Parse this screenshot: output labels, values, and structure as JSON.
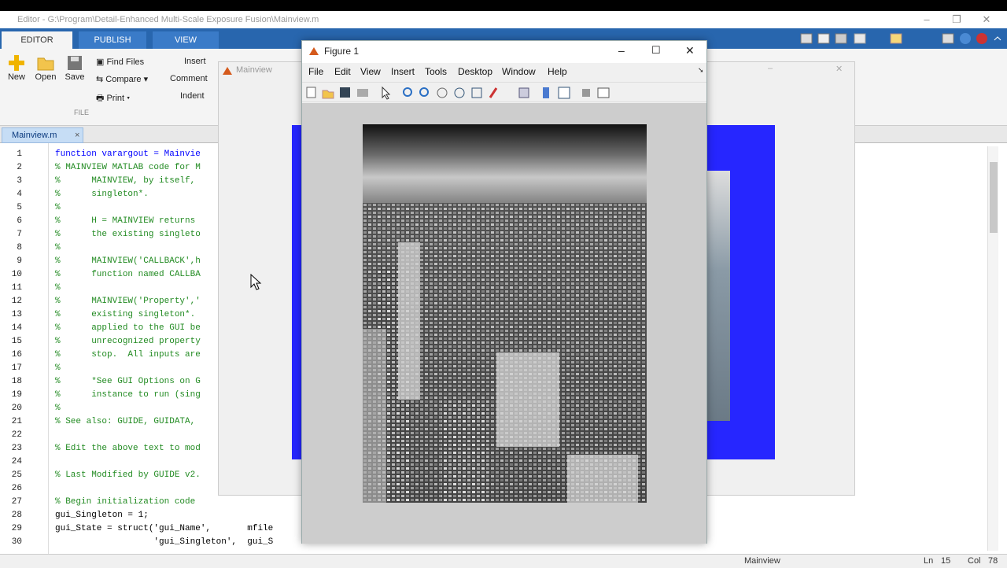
{
  "window": {
    "title": "Editor - G:\\Program\\Detail-Enhanced Multi-Scale Exposure Fusion\\Mainview.m"
  },
  "ribbon": {
    "tabs": [
      {
        "label": "EDITOR"
      },
      {
        "label": "PUBLISH"
      },
      {
        "label": "VIEW"
      }
    ],
    "new_label": "New",
    "open_label": "Open",
    "save_label": "Save",
    "find_files": "Find Files",
    "compare": "Compare",
    "print": "Print",
    "insert": "Insert",
    "comment": "Comment",
    "indent": "Indent",
    "section_file": "FILE"
  },
  "doc_tab": {
    "label": "Mainview.m"
  },
  "code_lines": [
    {
      "n": "1",
      "text": "function varargout = Mainvie",
      "type": "kw"
    },
    {
      "n": "2",
      "text": "% MAINVIEW MATLAB code for M",
      "type": "cm"
    },
    {
      "n": "3",
      "text": "%      MAINVIEW, by itself,",
      "type": "cm"
    },
    {
      "n": "4",
      "text": "%      singleton*.",
      "type": "cm"
    },
    {
      "n": "5",
      "text": "%",
      "type": "cm"
    },
    {
      "n": "6",
      "text": "%      H = MAINVIEW returns",
      "type": "cm"
    },
    {
      "n": "7",
      "text": "%      the existing singleto",
      "type": "cm"
    },
    {
      "n": "8",
      "text": "%",
      "type": "cm"
    },
    {
      "n": "9",
      "text": "%      MAINVIEW('CALLBACK',h",
      "type": "cm"
    },
    {
      "n": "10",
      "text": "%      function named CALLBA",
      "type": "cm"
    },
    {
      "n": "11",
      "text": "%",
      "type": "cm"
    },
    {
      "n": "12",
      "text": "%      MAINVIEW('Property','",
      "type": "cm"
    },
    {
      "n": "13",
      "text": "%      existing singleton*.",
      "type": "cm"
    },
    {
      "n": "14",
      "text": "%      applied to the GUI be",
      "type": "cm"
    },
    {
      "n": "15",
      "text": "%      unrecognized property",
      "type": "cm"
    },
    {
      "n": "16",
      "text": "%      stop.  All inputs are",
      "type": "cm"
    },
    {
      "n": "17",
      "text": "%",
      "type": "cm"
    },
    {
      "n": "18",
      "text": "%      *See GUI Options on G",
      "type": "cm"
    },
    {
      "n": "19",
      "text": "%      instance to run (sing",
      "type": "cm"
    },
    {
      "n": "20",
      "text": "%",
      "type": "cm"
    },
    {
      "n": "21",
      "text": "% See also: GUIDE, GUIDATA,",
      "type": "cm"
    },
    {
      "n": "22",
      "text": "",
      "type": "cm"
    },
    {
      "n": "23",
      "text": "% Edit the above text to mod",
      "type": "cm"
    },
    {
      "n": "24",
      "text": "",
      "type": "cm"
    },
    {
      "n": "25",
      "text": "% Last Modified by GUIDE v2.",
      "type": "cm"
    },
    {
      "n": "26",
      "text": "",
      "type": "cm"
    },
    {
      "n": "27",
      "text": "% Begin initialization code",
      "type": "cm"
    },
    {
      "n": "28",
      "text": "gui_Singleton = 1;",
      "type": "pl"
    },
    {
      "n": "29",
      "text": "gui_State = struct('gui_Name',       mfile",
      "type": "pl"
    },
    {
      "n": "30",
      "text": "                   'gui_Singleton',  gui_S",
      "type": "pl"
    }
  ],
  "mainview_window": {
    "title": "Mainview"
  },
  "figure": {
    "title": "Figure 1",
    "menus": [
      {
        "label": "File"
      },
      {
        "label": "Edit"
      },
      {
        "label": "View"
      },
      {
        "label": "Insert"
      },
      {
        "label": "Tools"
      },
      {
        "label": "Desktop"
      },
      {
        "label": "Window"
      },
      {
        "label": "Help"
      }
    ]
  },
  "status": {
    "script": "Mainview",
    "ln_label": "Ln",
    "ln": "15",
    "col_label": "Col",
    "col": "78"
  },
  "colors": {
    "ribbon_blue": "#2866ae",
    "panel_blue": "#2626ff",
    "comment_green": "#228b22"
  }
}
